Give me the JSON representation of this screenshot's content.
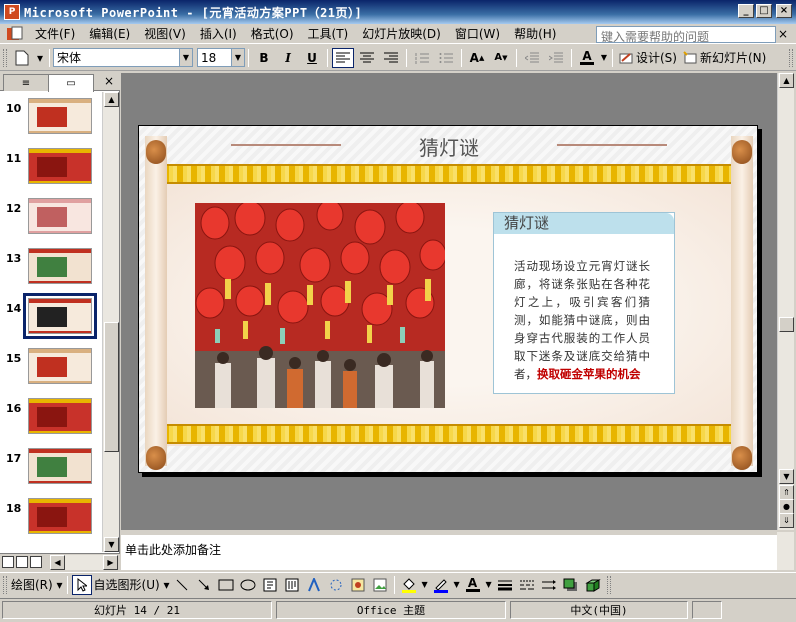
{
  "window": {
    "title": "Microsoft PowerPoint - [元宵活动方案PPT（21页）]",
    "app_icon_label": "P",
    "controls": {
      "minimize": "_",
      "maximize": "□",
      "close": "×"
    }
  },
  "menubar": {
    "items": [
      "文件(F)",
      "编辑(E)",
      "视图(V)",
      "插入(I)",
      "格式(O)",
      "工具(T)",
      "幻灯片放映(D)",
      "窗口(W)",
      "帮助(H)"
    ],
    "help_placeholder": "键入需要帮助的问题",
    "help_close": "×"
  },
  "toolbar": {
    "font_name": "宋体",
    "font_size": "18",
    "bold": "B",
    "italic": "I",
    "underline": "U",
    "font_color_label": "A",
    "design_label": "设计(S)",
    "new_slide_label": "新幻灯片(N)"
  },
  "left_pane": {
    "tab_outline_icon": "≡",
    "tab_slides_icon": "▭",
    "close": "×",
    "thumbnails": [
      {
        "num": "10",
        "style": "cream"
      },
      {
        "num": "11",
        "style": "red"
      },
      {
        "num": "12",
        "style": "pink"
      },
      {
        "num": "13",
        "style": "mixed"
      },
      {
        "num": "14",
        "style": "selected"
      },
      {
        "num": "15",
        "style": "cream"
      },
      {
        "num": "16",
        "style": "red"
      },
      {
        "num": "17",
        "style": "mixed"
      },
      {
        "num": "18",
        "style": "red"
      }
    ]
  },
  "slide": {
    "title": "猜灯谜",
    "info_title": "猜灯谜",
    "info_body": "活动现场设立元宵灯谜长廊，将谜条张贴在各种花灯之上，吸引宾客们猜测，如能猜中谜底，则由身穿古代服装的工作人员取下迷条及谜底交给猜中者，",
    "info_highlight": "换取砸金苹果的机会"
  },
  "notes": {
    "placeholder": "单击此处添加备注"
  },
  "drawbar": {
    "draw_label": "绘图(R)",
    "autoshapes_label": "自选图形(U)"
  },
  "statusbar": {
    "slide_info": "幻灯片 14 / 21",
    "theme": "Office 主题",
    "language": "中文(中国)"
  },
  "colors": {
    "title_bar": "#0a246a",
    "highlight_red": "#c00000",
    "gold": "#e8b500",
    "info_header": "#bde0ec"
  }
}
